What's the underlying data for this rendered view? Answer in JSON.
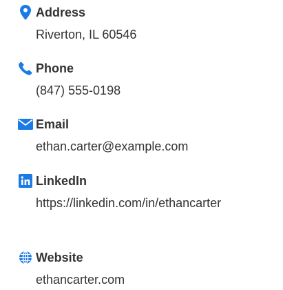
{
  "accent_color": "#1a7ae6",
  "contacts": [
    {
      "label": "Address",
      "value": "Riverton, IL 60546",
      "icon": "map-pin-icon"
    },
    {
      "label": "Phone",
      "value": "(847) 555-0198",
      "icon": "phone-icon"
    },
    {
      "label": "Email",
      "value": "ethan.carter@example.com",
      "icon": "envelope-icon"
    },
    {
      "label": "LinkedIn",
      "value": "https://linkedin.com/in/ethancarter",
      "icon": "linkedin-icon"
    },
    {
      "label": "Website",
      "value": "ethancarter.com",
      "icon": "globe-icon"
    }
  ]
}
